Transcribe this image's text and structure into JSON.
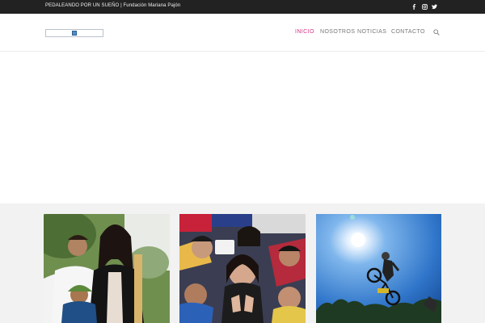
{
  "topbar": {
    "text": "PEDALEANDO POR UN SUEÑO | Fundación Mariana Pajón",
    "social": [
      "facebook-icon",
      "instagram-icon",
      "twitter-icon"
    ]
  },
  "nav": {
    "items": [
      {
        "label": "INICIO",
        "active": true
      },
      {
        "label": "NOSOTROS",
        "active": false
      },
      {
        "label": "NOTICIAS",
        "active": false
      },
      {
        "label": "CONTACTO",
        "active": false
      }
    ],
    "search_icon": "search-icon"
  },
  "colors": {
    "topbar_bg": "#222222",
    "accent": "#d63384",
    "nav_text": "#777777",
    "band_bg": "#f2f2f2"
  },
  "cards": [
    {
      "image": "photo-rider-with-family"
    },
    {
      "image": "photo-rider-with-fans"
    },
    {
      "image": "photo-bmx-jump"
    }
  ]
}
